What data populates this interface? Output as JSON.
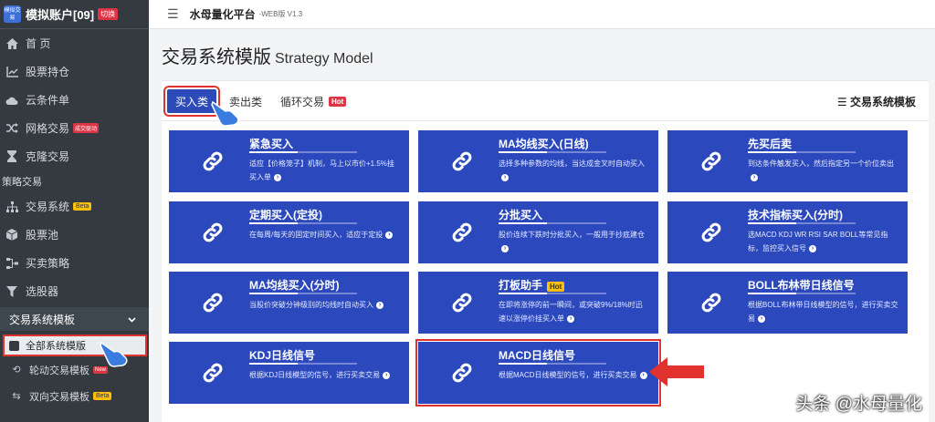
{
  "account": {
    "logo_text": "模拟交易",
    "name": "模拟账户[09]",
    "badge": "切换"
  },
  "sidebar": {
    "items": [
      {
        "label": "首 页",
        "icon": "home-icon"
      },
      {
        "label": "股票持仓",
        "icon": "chart-line-icon"
      },
      {
        "label": "云条件单",
        "icon": "cloud-icon"
      },
      {
        "label": "网格交易",
        "icon": "shuffle-icon",
        "badge": "成交驱动"
      },
      {
        "label": "克隆交易",
        "icon": "hourglass-icon"
      }
    ],
    "section": "策略交易",
    "strategy_items": [
      {
        "label": "交易系统",
        "icon": "sitemap-icon",
        "badge": "Beta"
      },
      {
        "label": "股票池",
        "icon": "cube-icon"
      },
      {
        "label": "买卖策略",
        "icon": "network-icon"
      },
      {
        "label": "选股器",
        "icon": "filter-icon"
      }
    ],
    "group": "交易系统模板",
    "active_item": "全部系统模版",
    "sub_items": [
      {
        "label": "轮动交易模板",
        "icon": "rotate-icon",
        "badge": "New"
      },
      {
        "label": "双向交易模板",
        "icon": "swap-icon",
        "badge": "Beta"
      }
    ]
  },
  "topbar": {
    "brand": "水母量化平台",
    "version": "-WEB版 V1.3"
  },
  "page": {
    "title": "交易系统模版",
    "title_en": "Strategy Model",
    "tabs": [
      {
        "label": "买入类",
        "active": true
      },
      {
        "label": "卖出类"
      },
      {
        "label": "循环交易",
        "badge": "Hot"
      }
    ],
    "right_link": "☰ 交易系统模板"
  },
  "tiles": [
    {
      "title": "紧急买入",
      "desc": "适应【价格笼子】机制，马上以市价+1.5%挂买入单"
    },
    {
      "title": "MA均线买入(日线)",
      "desc": "选择多种参数的均线，当达成金叉时自动买入"
    },
    {
      "title": "先买后卖",
      "desc": "到达条件触发买入，然后指定另一个价位卖出"
    },
    {
      "title": "定期买入(定投)",
      "desc": "在每周/每天的固定时间买入，适应于定投"
    },
    {
      "title": "分批买入",
      "desc": "股价连续下跌时分批买入，一般用于抄底建仓"
    },
    {
      "title": "技术指标买入(分时)",
      "desc": "选MACD KDJ WR RSI SAR BOLL等常见指标，监控买入信号"
    },
    {
      "title": "MA均线买入(分时)",
      "desc": "当股价突破分钟级别的均线时自动买入"
    },
    {
      "title": "打板助手",
      "badge": "Hot",
      "desc": "在即将涨停的前一瞬间，或突破9%/18%时迅速以涨停价挂买入单"
    },
    {
      "title": "BOLL布林带日线信号",
      "desc": "根据BOLL布林带日线模型的信号，进行买卖交易"
    },
    {
      "title": "KDJ日线信号",
      "desc": "根据KDJ日线模型的信号，进行买卖交易"
    },
    {
      "title": "MACD日线信号",
      "desc": "根据MACD日线模型的信号，进行买卖交易"
    }
  ],
  "watermark": "头条 @水母量化",
  "colors": {
    "tile": "#2b48bd",
    "sidebar": "#343a40",
    "highlight": "#e0322f"
  }
}
